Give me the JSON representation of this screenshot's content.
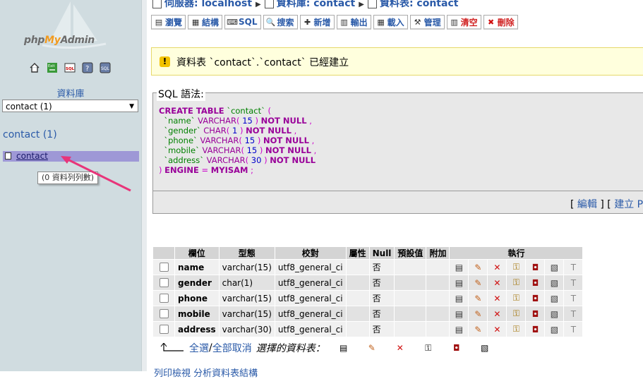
{
  "sidebar": {
    "logo_text_php": "php",
    "logo_text_my": "My",
    "logo_text_admin": "Admin",
    "icons": [
      "home-icon",
      "exit-icon",
      "sql-icon",
      "help-icon",
      "docs-icon"
    ],
    "db_label": "資料庫",
    "db_selected": "contact (1)",
    "db_title": "contact (1)",
    "table_item": "contact",
    "tooltip": "(0 資料列列數)"
  },
  "breadcrumb": {
    "server": "伺服器: localhost",
    "database": "資料庫: contact",
    "table": "資料表: contact"
  },
  "tabs": [
    {
      "label": "瀏覽",
      "icon": "browse-icon"
    },
    {
      "label": "結構",
      "icon": "structure-icon"
    },
    {
      "label": "SQL",
      "icon": "sql-icon"
    },
    {
      "label": "搜索",
      "icon": "search-icon"
    },
    {
      "label": "新增",
      "icon": "insert-icon"
    },
    {
      "label": "輸出",
      "icon": "export-icon"
    },
    {
      "label": "載入",
      "icon": "import-icon"
    },
    {
      "label": "管理",
      "icon": "operations-icon"
    },
    {
      "label": "清空",
      "icon": "empty-icon"
    },
    {
      "label": "刪除",
      "icon": "drop-icon"
    }
  ],
  "notice": "資料表 `contact`.`contact` 已經建立",
  "sql": {
    "legend": "SQL 語法:",
    "edit": "編輯",
    "create_php": "建立 P",
    "open_bracket": "[ ",
    "mid_bracket": " ] [ "
  },
  "fields_table": {
    "headers": [
      "欄位",
      "型態",
      "校對",
      "屬性",
      "Null",
      "預設值",
      "附加",
      "執行"
    ],
    "rows": [
      {
        "name": "name",
        "type": "varchar(15)",
        "collation": "utf8_general_ci",
        "null": "否"
      },
      {
        "name": "gender",
        "type": "char(1)",
        "collation": "utf8_general_ci",
        "null": "否"
      },
      {
        "name": "phone",
        "type": "varchar(15)",
        "collation": "utf8_general_ci",
        "null": "否"
      },
      {
        "name": "mobile",
        "type": "varchar(15)",
        "collation": "utf8_general_ci",
        "null": "否"
      },
      {
        "name": "address",
        "type": "varchar(30)",
        "collation": "utf8_general_ci",
        "null": "否"
      }
    ]
  },
  "bulk": {
    "check_all": "全選",
    "separator": " / ",
    "uncheck_all": "全部取消",
    "with_selected": "選擇的資料表："
  },
  "bottom_cut": "列印檢視   分析資料表結構"
}
